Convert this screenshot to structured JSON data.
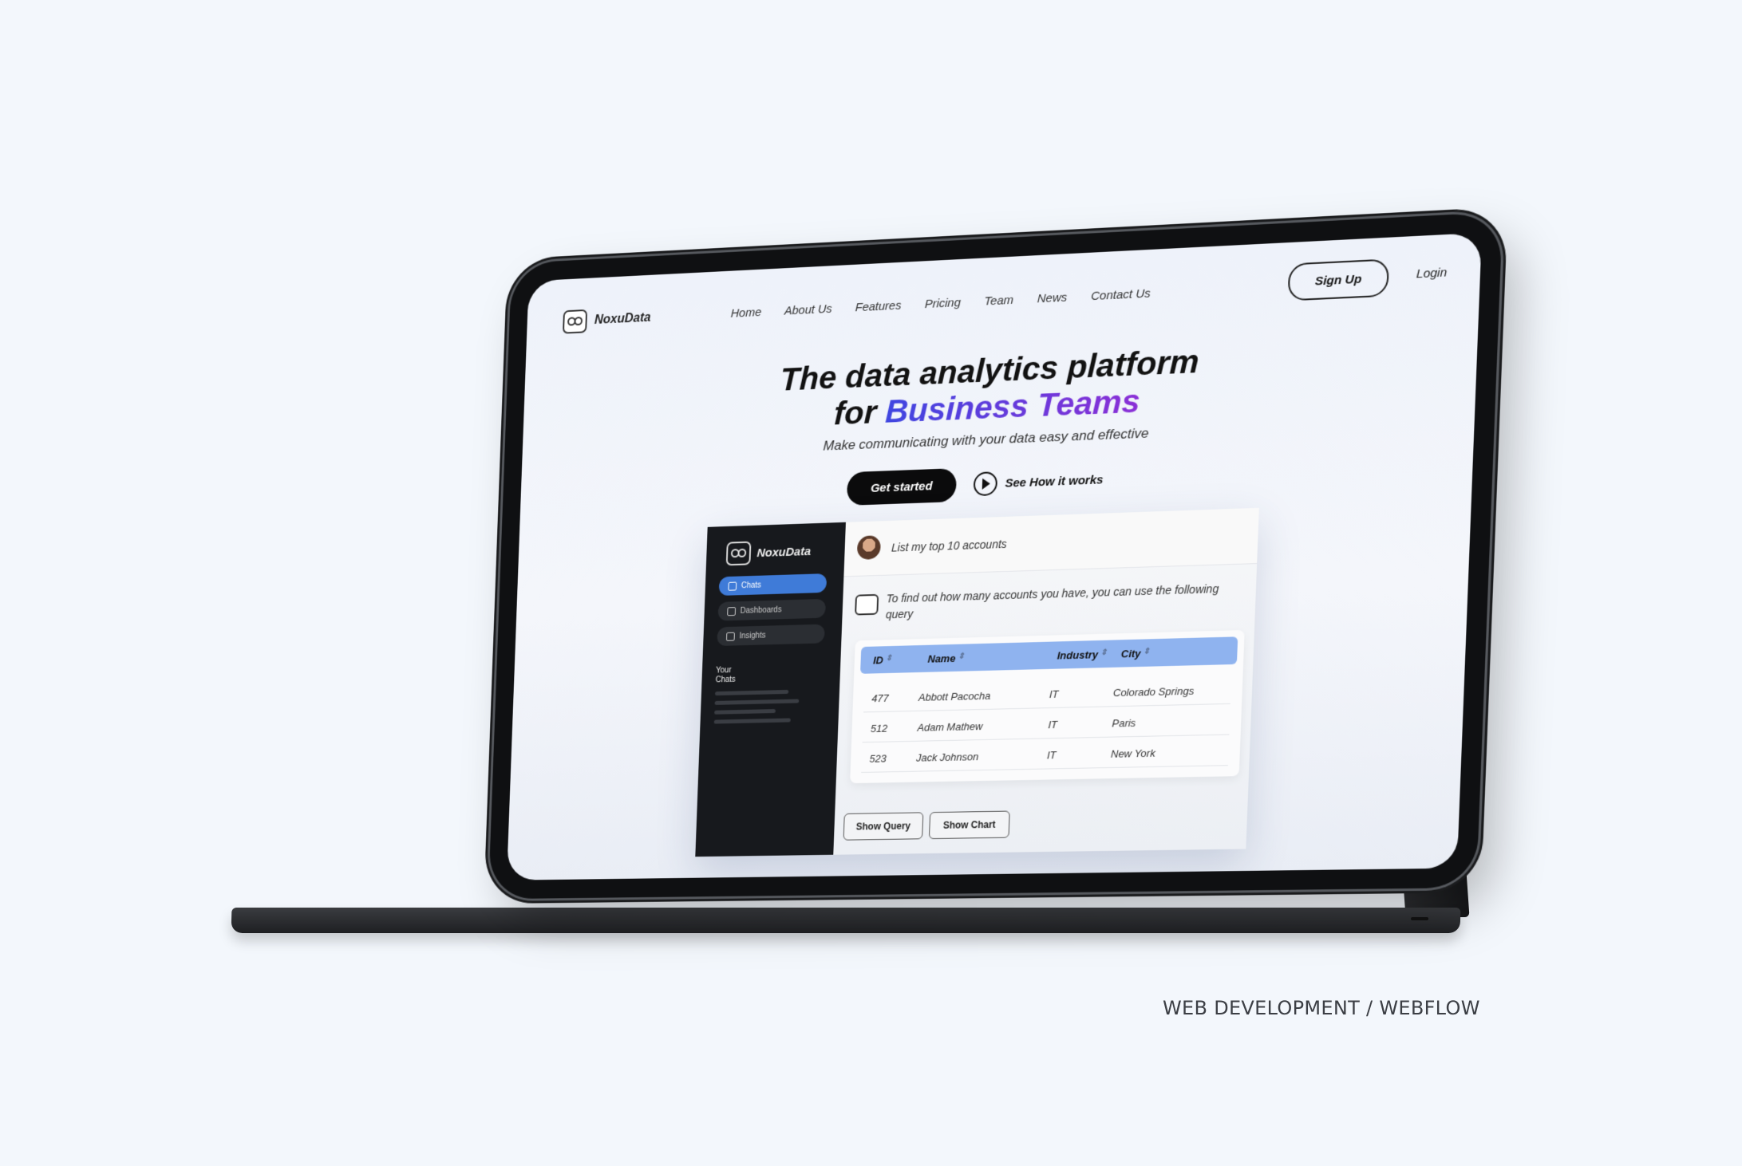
{
  "nav": {
    "logo_text": "NoxuData",
    "links": [
      "Home",
      "About Us",
      "Features",
      "Pricing",
      "Team",
      "News",
      "Contact Us"
    ],
    "signup_label": "Sign Up",
    "login_label": "Login"
  },
  "hero": {
    "title_line1": "The data analytics platform",
    "title_line2_prefix": "for ",
    "title_line2_accent": "Business Teams",
    "subtitle": "Make communicating with your data easy and effective",
    "cta_primary": "Get started",
    "cta_secondary": "See How it works"
  },
  "app": {
    "logo_text": "NoxuData",
    "sidebar": {
      "items": [
        {
          "label": "Chats",
          "icon": "chat-icon",
          "active": true
        },
        {
          "label": "Dashboards",
          "icon": "dashboard-icon",
          "active": false
        },
        {
          "label": "Insights",
          "icon": "insights-icon",
          "active": false
        }
      ],
      "section_label": "Your Chats"
    },
    "prompt": "List my top 10 accounts",
    "response": "To find out how many accounts you have, you can use the following query",
    "table": {
      "columns": [
        "ID",
        "Name",
        "Industry",
        "City"
      ],
      "rows": [
        [
          "477",
          "Abbott Pacocha",
          "IT",
          "Colorado Springs"
        ],
        [
          "512",
          "Adam Mathew",
          "IT",
          "Paris"
        ],
        [
          "523",
          "Jack Johnson",
          "IT",
          "New York"
        ]
      ]
    },
    "buttons": {
      "show_query": "Show Query",
      "show_chart": "Show Chart"
    }
  },
  "caption": "WEB DEVELOPMENT / WEBFLOW",
  "colors": {
    "page_bg": "#f3f7fc",
    "accent_start": "#3f46e0",
    "accent_end": "#8b2fd6",
    "active_sidebar": "#3f7bd8",
    "table_header": "#8fb3ef"
  }
}
